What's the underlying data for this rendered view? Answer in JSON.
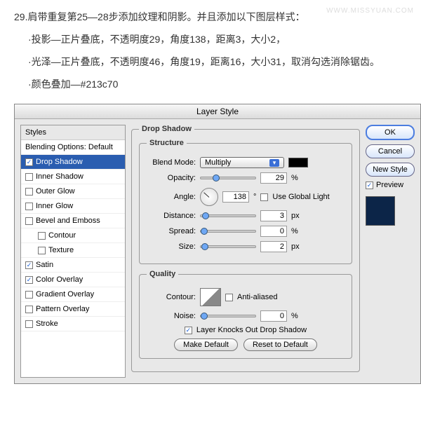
{
  "watermark": "WWW.MISSYUAN.COM",
  "intro": {
    "l1": "29.肩带重复第25—28步添加纹理和阴影。并且添加以下图层样式：",
    "l2": "·投影—正片叠底，不透明度29，角度138，距离3，大小2，",
    "l3": "·光泽—正片叠底，不透明度46，角度19，距离16，大小31，取消勾选消除锯齿。",
    "l4": "·颜色叠加—#213c70"
  },
  "title": "Layer Style",
  "stylesHeader": "Styles",
  "blendingOptions": "Blending Options: Default",
  "effects": {
    "dropShadow": "Drop Shadow",
    "innerShadow": "Inner Shadow",
    "outerGlow": "Outer Glow",
    "innerGlow": "Inner Glow",
    "bevelEmboss": "Bevel and Emboss",
    "contour": "Contour",
    "texture": "Texture",
    "satin": "Satin",
    "colorOverlay": "Color Overlay",
    "gradientOverlay": "Gradient Overlay",
    "patternOverlay": "Pattern Overlay",
    "stroke": "Stroke"
  },
  "legend": {
    "dropShadow": "Drop Shadow",
    "structure": "Structure",
    "quality": "Quality"
  },
  "labels": {
    "blendMode": "Blend Mode:",
    "opacity": "Opacity:",
    "angle": "Angle:",
    "useGlobal": "Use Global Light",
    "distance": "Distance:",
    "spread": "Spread:",
    "size": "Size:",
    "contour": "Contour:",
    "antiAliased": "Anti-aliased",
    "noise": "Noise:",
    "knocksOut": "Layer Knocks Out Drop Shadow",
    "makeDefault": "Make Default",
    "resetDefault": "Reset to Default"
  },
  "values": {
    "blendMode": "Multiply",
    "opacity": "29",
    "angle": "138",
    "distance": "3",
    "spread": "0",
    "size": "2",
    "noise": "0"
  },
  "units": {
    "pct": "%",
    "deg": "°",
    "px": "px"
  },
  "buttons": {
    "ok": "OK",
    "cancel": "Cancel",
    "newStyle": "New Style",
    "preview": "Preview"
  },
  "checks": {
    "dropShadow": true,
    "satin": true,
    "colorOverlay": true,
    "preview": true,
    "knocksOut": true
  }
}
